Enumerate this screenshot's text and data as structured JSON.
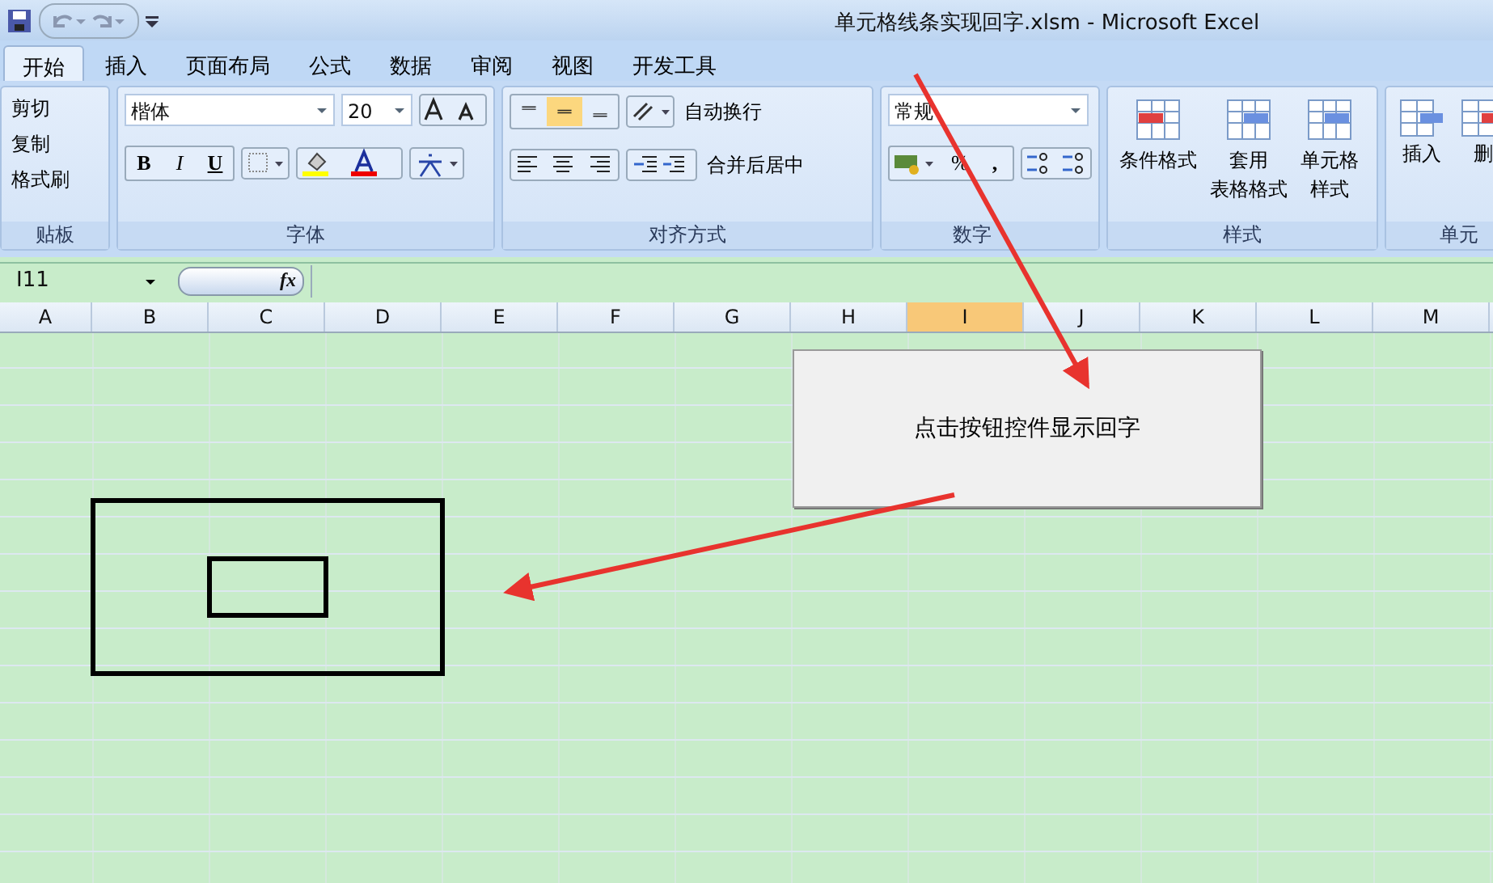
{
  "window": {
    "title": "单元格线条实现回字.xlsm - Microsoft Excel"
  },
  "tabs": [
    {
      "label": "开始",
      "selected": true
    },
    {
      "label": "插入",
      "selected": false
    },
    {
      "label": "页面布局",
      "selected": false
    },
    {
      "label": "公式",
      "selected": false
    },
    {
      "label": "数据",
      "selected": false
    },
    {
      "label": "审阅",
      "selected": false
    },
    {
      "label": "视图",
      "selected": false
    },
    {
      "label": "开发工具",
      "selected": false
    }
  ],
  "clipboard": {
    "label": "贴板",
    "items": [
      "剪切",
      "复制",
      "格式刷"
    ]
  },
  "font": {
    "label": "字体",
    "name": "楷体",
    "size": "20",
    "bold": "B",
    "italic": "I",
    "underline": "U"
  },
  "alignment": {
    "label": "对齐方式",
    "vertical": [
      {
        "selected": false
      },
      {
        "selected": true
      },
      {
        "selected": false
      }
    ],
    "wrap": "自动换行",
    "merge": "合并后居中"
  },
  "number": {
    "label": "数字",
    "format": "常规",
    "percent": "%",
    "comma": ","
  },
  "styles": {
    "label": "样式",
    "items": [
      {
        "lines": [
          "条件格式"
        ]
      },
      {
        "lines": [
          "套用",
          "表格格式"
        ]
      },
      {
        "lines": [
          "单元格",
          "样式"
        ]
      }
    ]
  },
  "cells": {
    "label": "单元",
    "items": [
      "插入",
      "删"
    ]
  },
  "formula_bar": {
    "name_box": "I11",
    "fx": "fx"
  },
  "columns": [
    {
      "label": "A",
      "selected": false
    },
    {
      "label": "B",
      "selected": false
    },
    {
      "label": "C",
      "selected": false
    },
    {
      "label": "D",
      "selected": false
    },
    {
      "label": "E",
      "selected": false
    },
    {
      "label": "F",
      "selected": false
    },
    {
      "label": "G",
      "selected": false
    },
    {
      "label": "H",
      "selected": false
    },
    {
      "label": "I",
      "selected": true
    },
    {
      "label": "J",
      "selected": false
    },
    {
      "label": "K",
      "selected": false
    },
    {
      "label": "L",
      "selected": false
    },
    {
      "label": "M",
      "selected": false
    }
  ],
  "sheet_button": {
    "label": "点击按钮控件显示回字"
  }
}
